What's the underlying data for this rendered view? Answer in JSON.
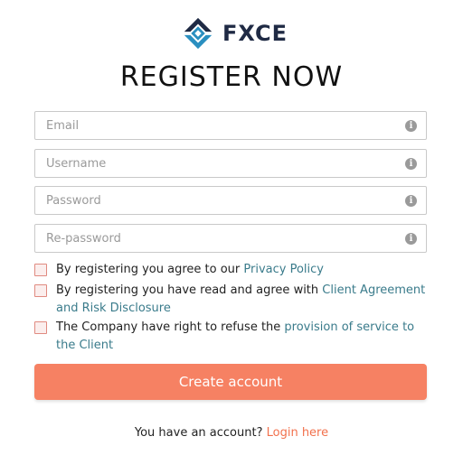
{
  "brand": {
    "name": "FXCE"
  },
  "title": "REGISTER NOW",
  "fields": {
    "email": {
      "placeholder": "Email",
      "value": ""
    },
    "username": {
      "placeholder": "Username",
      "value": ""
    },
    "password": {
      "placeholder": "Password",
      "value": ""
    },
    "repassword": {
      "placeholder": "Re-password",
      "value": ""
    }
  },
  "consents": {
    "privacy": {
      "text": "By registering you agree to our ",
      "link": "Privacy Policy"
    },
    "agreement": {
      "text": "By registering you have read and agree with ",
      "link": "Client Agreement and Risk Disclosure"
    },
    "refuse": {
      "text": "The Company have right to refuse the ",
      "link": "provision of service to the Client"
    }
  },
  "create_button": "Create account",
  "footer": {
    "text": "You have an account? ",
    "link": "Login here"
  },
  "icons": {
    "info": "info-icon",
    "logo": "fxce-logo-icon"
  },
  "colors": {
    "accent": "#f68163",
    "link": "#3a7b8b",
    "login_link": "#f2714d",
    "brand_dark": "#1f2a44",
    "brand_blue": "#2a8fc0"
  }
}
